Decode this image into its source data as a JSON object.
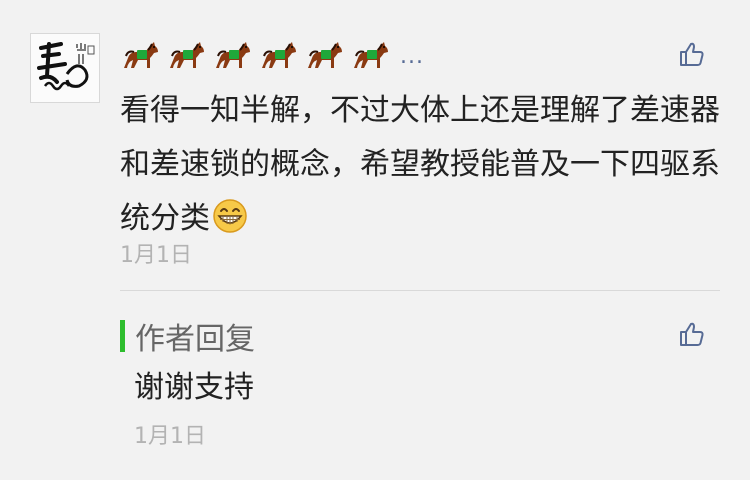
{
  "comment": {
    "username_emoji": "horse-emoji",
    "username_emoji_count": 6,
    "username_suffix": "...",
    "text": "看得一知半解，不过大体上还是理解了差速器和差速锁的概念，希望教授能普及一下四驱系统分类",
    "emoji": "grinning-face-emoji",
    "date": "1月1日"
  },
  "reply": {
    "label": "作者回复",
    "text": "谢谢支持",
    "date": "1月1日"
  },
  "colors": {
    "background": "#f2f2f2",
    "link": "#576b95",
    "accent_bar": "#2dbd2d",
    "date": "#b3b3b3"
  }
}
